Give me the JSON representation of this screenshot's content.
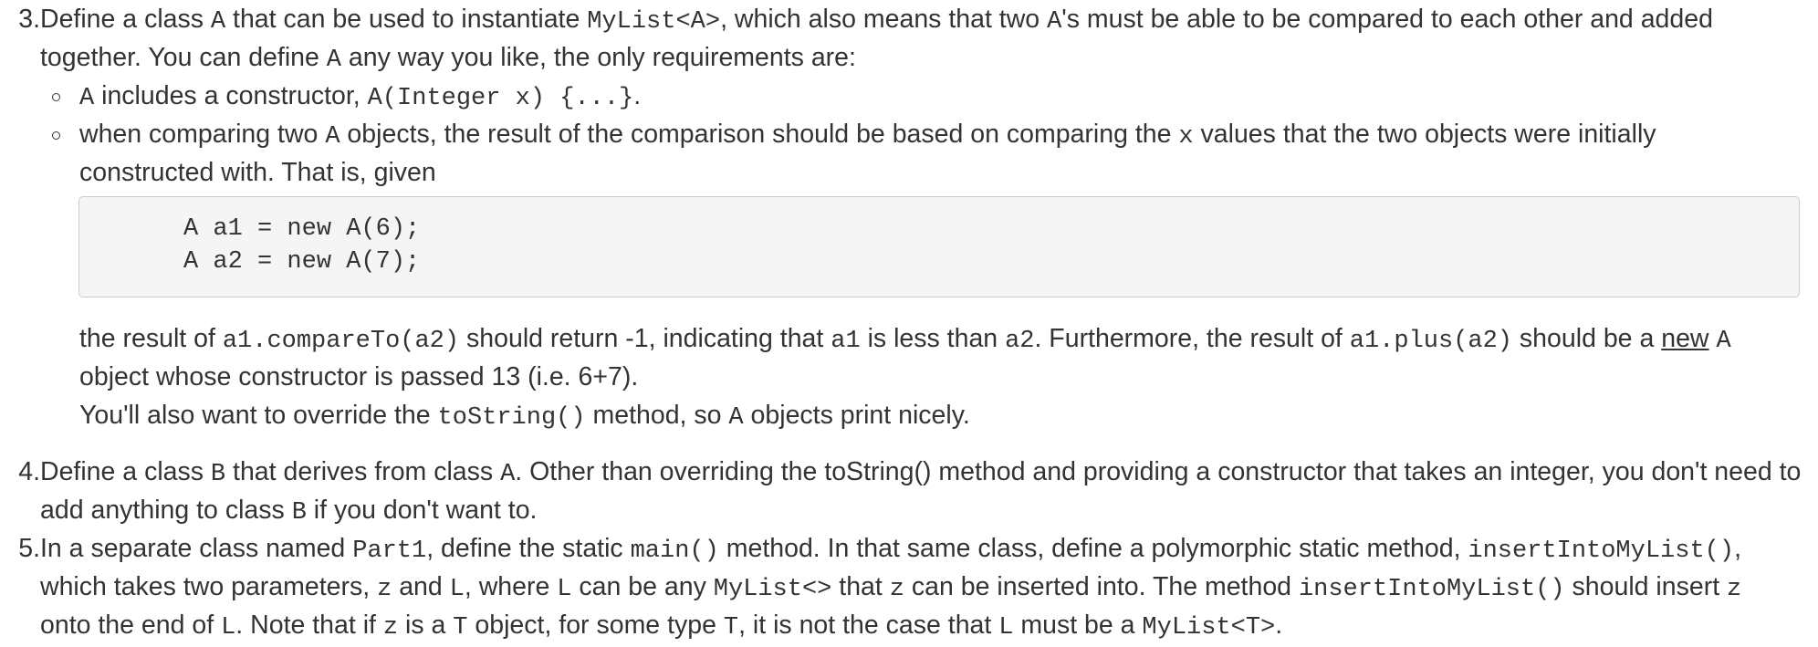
{
  "items": {
    "q3": {
      "number": "3.",
      "l1": [
        "Define a class ",
        "A",
        " that can be used to instantiate ",
        "MyList<A>",
        ", which also means that two ",
        "A",
        "'s must be able to be compared to each other and added"
      ],
      "l2": [
        "together. You can define ",
        "A",
        " any way you like, the only requirements are:"
      ],
      "b1": [
        "A",
        " includes a constructor, ",
        "A(Integer x) {...}",
        "."
      ],
      "b2l1": [
        "when comparing two ",
        "A",
        " objects, the result of the comparison should be based on comparing the ",
        "x",
        " values that the two objects were initially"
      ],
      "b2l2": "constructed with. That is, given",
      "code_l1": "A a1 = new A(6);",
      "code_l2": "A a2 = new A(7);",
      "p1": [
        "the result of ",
        "a1.compareTo(a2)",
        " should return -1, indicating that ",
        "a1",
        " is less than ",
        "a2",
        ". Furthermore, the result of ",
        "a1.plus(a2)",
        " should be a ",
        "new",
        " ",
        "A"
      ],
      "p2": "object whose constructor is passed 13 (i.e. 6+7).",
      "p3": [
        "You'll also want to override the ",
        "toString()",
        " method, so ",
        "A",
        " objects print nicely."
      ]
    },
    "q4": {
      "number": "4.",
      "l1": [
        "Define a class ",
        "B",
        " that derives from class ",
        "A",
        ". Other than overriding the toString() method and providing a constructor that takes an integer, you don't need to"
      ],
      "l2": [
        "add anything to class ",
        "B",
        " if you don't want to."
      ]
    },
    "q5": {
      "number": "5.",
      "l1": [
        "In a separate class named ",
        "Part1",
        ", define the static ",
        "main()",
        " method. In that same class, define a polymorphic static method, ",
        "insertIntoMyList()",
        ","
      ],
      "l2": [
        "which takes two parameters, ",
        "z",
        " and ",
        "L",
        ", where ",
        "L",
        " can be any ",
        "MyList<>",
        " that ",
        "z",
        " can be inserted into. The method ",
        "insertIntoMyList()",
        " should insert ",
        "z"
      ],
      "l3": [
        "onto the end of ",
        "L",
        ". Note that if ",
        "z",
        " is a ",
        "T",
        " object, for some type ",
        "T",
        ", it is not the case that ",
        "L",
        " must be a ",
        "MyList<T>",
        "."
      ]
    }
  }
}
